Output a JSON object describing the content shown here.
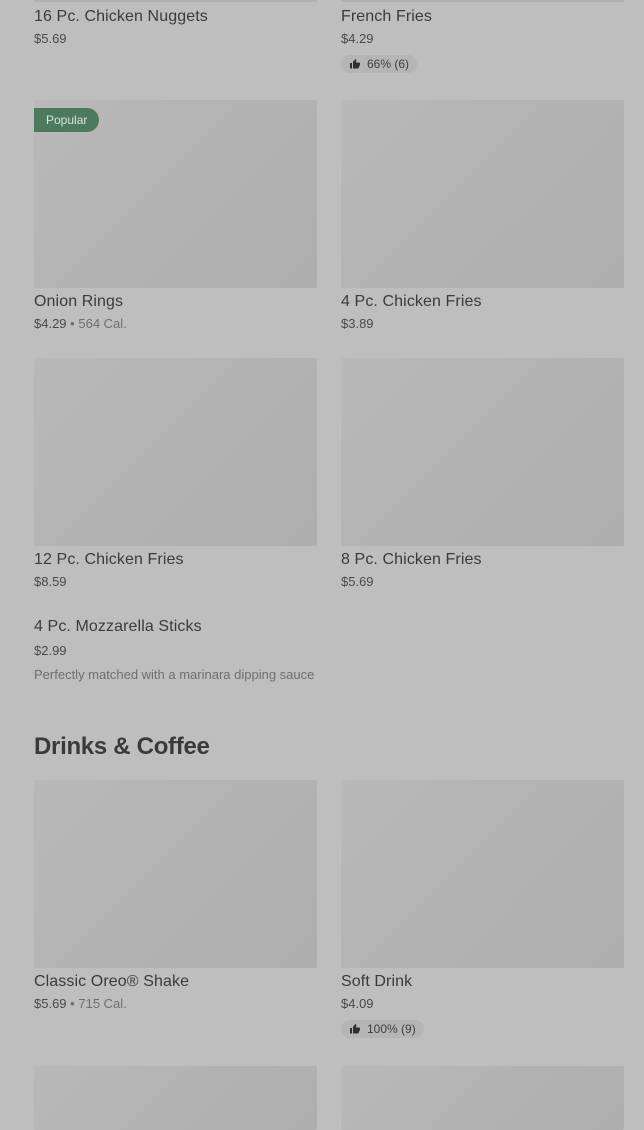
{
  "items": [
    {
      "name": "16 Pc. Chicken Nuggets",
      "price": "$5.69"
    },
    {
      "name": "French Fries",
      "price": "$4.29",
      "rating": "66% (6)"
    },
    {
      "name": "Onion Rings",
      "price": "$4.29",
      "calories": "564 Cal.",
      "badge": "Popular"
    },
    {
      "name": "4 Pc. Chicken Fries",
      "price": "$3.89"
    },
    {
      "name": "12 Pc. Chicken Fries",
      "price": "$8.59"
    },
    {
      "name": "8 Pc. Chicken Fries",
      "price": "$5.69"
    },
    {
      "name": "4 Pc. Mozzarella Sticks",
      "price": "$2.99",
      "description": "Perfectly matched with a marinara dipping sauce"
    },
    {
      "name": "Classic Oreo® Shake",
      "price": "$5.69",
      "calories": "715 Cal."
    },
    {
      "name": "Soft Drink",
      "price": "$4.09",
      "rating": "100% (9)"
    }
  ],
  "sections": {
    "drinks_title": "Drinks & Coffee"
  },
  "separator": "•",
  "icons": {
    "rating": "thumbs-up-icon"
  },
  "colors": {
    "badge_bg": "#4b7b5c",
    "page_bg": "#bebebe"
  }
}
